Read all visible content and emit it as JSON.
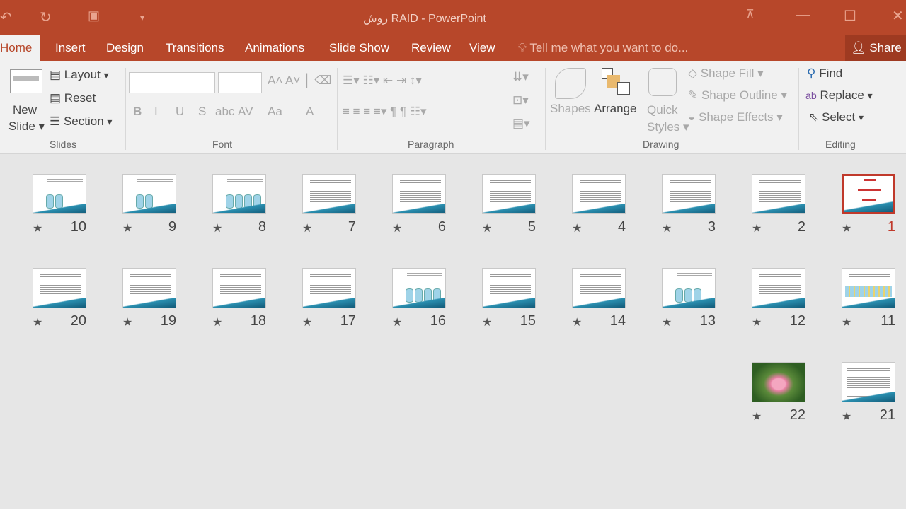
{
  "window": {
    "title": "روش RAID  - PowerPoint",
    "qat_icons": [
      "undo-icon",
      "redo-icon",
      "slideshow-start-icon",
      "customize-qat-icon"
    ]
  },
  "tabs": [
    "Home",
    "Insert",
    "Design",
    "Transitions",
    "Animations",
    "Slide Show",
    "Review",
    "View"
  ],
  "tell_me": "Tell me what you want to do...",
  "share": "Share",
  "ribbon": {
    "slides": {
      "new_slide_1": "New",
      "new_slide_2": "Slide",
      "layout": "Layout",
      "reset": "Reset",
      "section": "Section",
      "label": "Slides"
    },
    "font": {
      "label": "Font",
      "buttons": [
        "B",
        "I",
        "U",
        "S",
        "abc",
        "AV",
        "Aa",
        "A"
      ]
    },
    "paragraph": {
      "label": "Paragraph"
    },
    "drawing": {
      "shapes": "Shapes",
      "arrange": "Arrange",
      "quick_1": "Quick",
      "quick_2": "Styles",
      "shape_fill": "Shape Fill",
      "shape_outline": "Shape Outline",
      "shape_effects": "Shape Effects",
      "label": "Drawing"
    },
    "editing": {
      "find": "Find",
      "replace": "Replace",
      "select": "Select",
      "label": "Editing"
    }
  },
  "slides": [
    {
      "n": "1",
      "kind": "title",
      "selected": true
    },
    {
      "n": "2",
      "kind": "text"
    },
    {
      "n": "3",
      "kind": "text"
    },
    {
      "n": "4",
      "kind": "text"
    },
    {
      "n": "5",
      "kind": "text"
    },
    {
      "n": "6",
      "kind": "text"
    },
    {
      "n": "7",
      "kind": "text"
    },
    {
      "n": "8",
      "kind": "cyl4"
    },
    {
      "n": "9",
      "kind": "cyl2"
    },
    {
      "n": "10",
      "kind": "cyl2"
    },
    {
      "n": "11",
      "kind": "table"
    },
    {
      "n": "12",
      "kind": "text"
    },
    {
      "n": "13",
      "kind": "cyl3"
    },
    {
      "n": "14",
      "kind": "text"
    },
    {
      "n": "15",
      "kind": "text"
    },
    {
      "n": "16",
      "kind": "cyl4"
    },
    {
      "n": "17",
      "kind": "text"
    },
    {
      "n": "18",
      "kind": "text"
    },
    {
      "n": "19",
      "kind": "text"
    },
    {
      "n": "20",
      "kind": "text"
    },
    {
      "n": "21",
      "kind": "list"
    },
    {
      "n": "22",
      "kind": "flower"
    }
  ]
}
